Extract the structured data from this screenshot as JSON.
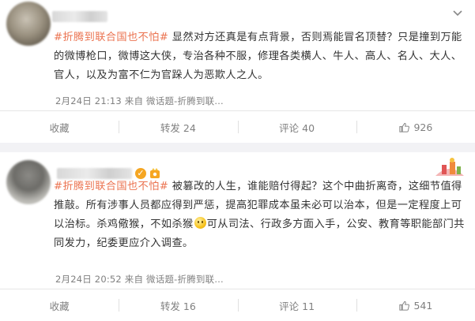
{
  "posts": [
    {
      "nickname": "",
      "hashtag": "#折腾到联合国也不怕#",
      "body": " 显然对方还真是有点背景，否则焉能冒名顶替？只是撞到万能的微博枪口，微博这大侠，专治各种不服，修理各类横人、牛人、高人、名人、大人、官人，以及为富不仁为官跺人为恶欺人之人。",
      "meta": "2月24日 21:13 来自 微话题-折腾到联…",
      "actions": {
        "favorite": "收藏",
        "repost": "转发 24",
        "comment": "评论 40",
        "like": "926"
      }
    },
    {
      "nickname": "",
      "hashtag": "#折腾到联合国也不怕#",
      "body_before_emoji": " 被篡改的人生，谁能赔付得起？这个中曲折离奇，这细节值得推敲。所有涉事人员都应得到严惩，提高犯罪成本虽未必可以治本，但是一定程度上可以治标。杀鸡儆猴，不如杀猴",
      "body_after_emoji": "可从司法、行政多方面入手，公安、教育等职能部门共同发力，纪委更应介入调查。",
      "meta": "2月24日 20:52 来自 微话题-折腾到联…",
      "actions": {
        "favorite": "收藏",
        "repost": "转发 16",
        "comment": "评论 11",
        "like": "541"
      }
    }
  ],
  "icons": {
    "more": "chevron-down-icon",
    "like": "thumbs-up-icon",
    "verified": "verified-v-icon",
    "badge": "member-badge-icon",
    "emoji": "smile-emoji-icon",
    "decoration": "card-decoration-icon"
  },
  "colors": {
    "hashtag": "#eb7350",
    "text": "#333333",
    "meta": "#808080",
    "background": "#f2f2f5"
  }
}
